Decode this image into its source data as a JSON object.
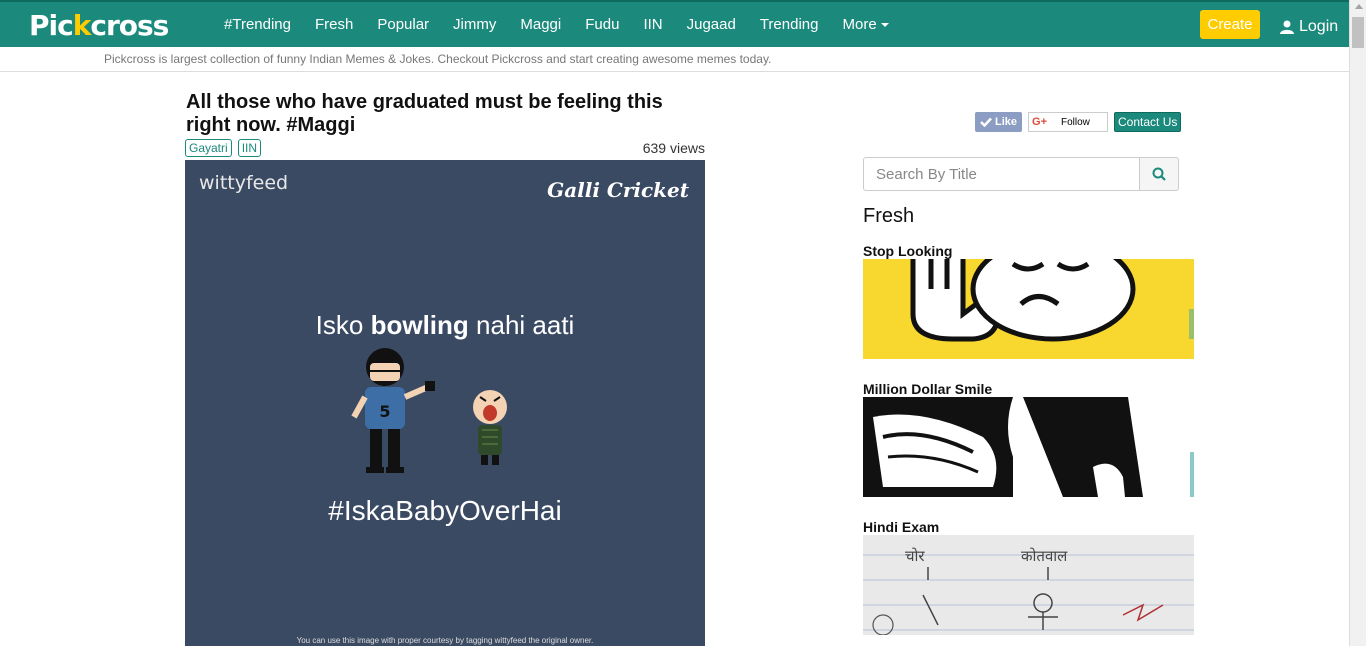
{
  "header": {
    "logo_left": "Pic",
    "logo_k": "k",
    "logo_right": "cross",
    "nav": [
      "#Trending",
      "Fresh",
      "Popular",
      "Jimmy",
      "Maggi",
      "Fudu",
      "IIN",
      "Jugaad",
      "Trending"
    ],
    "more_label": "More",
    "create_label": "Create",
    "login_label": "Login"
  },
  "tagline": "Pickcross is largest collection of funny Indian Memes & Jokes. Checkout Pickcross and start creating awesome memes today.",
  "post": {
    "title": "All those who have graduated must be feeling this right now. #Maggi",
    "tags": [
      "Gayatri",
      "IIN"
    ],
    "views": "639 views",
    "image": {
      "brand_left": "wittyfeed",
      "brand_right": "Galli Cricket",
      "line_prefix": "Isko ",
      "line_bold": "bowling",
      "line_suffix": " nahi aati",
      "jersey_number": "5",
      "hashtag": "#IskaBabyOverHai",
      "courtesy": "You can use this image with proper courtesy by tagging wittyfeed the original owner."
    }
  },
  "sidebar": {
    "like_label": "Like",
    "gplus_label": "G+",
    "follow_label": "Follow",
    "contact_label": "Contact Us",
    "search_placeholder": "Search By Title",
    "fresh_heading": "Fresh",
    "cards": [
      {
        "title": "Stop Looking"
      },
      {
        "title": "Million Dollar Smile"
      },
      {
        "title": "Hindi Exam",
        "word_left": "चोर",
        "word_right": "कोतवाल"
      }
    ]
  },
  "colors": {
    "brand": "#1b8a7c",
    "accent": "#ffcc00",
    "meme_bg": "#3b4a63"
  }
}
